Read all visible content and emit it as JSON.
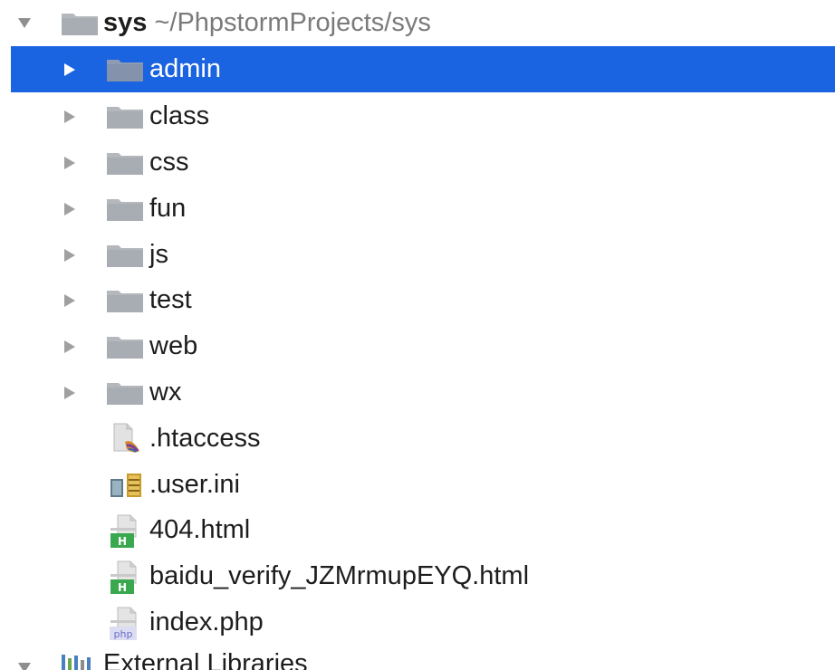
{
  "tree": {
    "root": {
      "name": "sys",
      "path": "~/PhpstormProjects/sys",
      "icon": "folder-icon",
      "expanded": true
    },
    "folders": [
      {
        "name": "admin",
        "icon": "folder-icon",
        "selected": true
      },
      {
        "name": "class",
        "icon": "folder-icon"
      },
      {
        "name": "css",
        "icon": "folder-icon"
      },
      {
        "name": "fun",
        "icon": "folder-icon"
      },
      {
        "name": "js",
        "icon": "folder-icon"
      },
      {
        "name": "test",
        "icon": "folder-icon"
      },
      {
        "name": "web",
        "icon": "folder-icon"
      },
      {
        "name": "wx",
        "icon": "folder-icon"
      }
    ],
    "files": [
      {
        "name": ".htaccess",
        "icon": "htaccess-file-icon"
      },
      {
        "name": ".user.ini",
        "icon": "ini-file-icon"
      },
      {
        "name": "404.html",
        "icon": "html-file-icon",
        "badge": "H"
      },
      {
        "name": "baidu_verify_JZMrmupEYQ.html",
        "icon": "html-file-icon",
        "badge": "H"
      },
      {
        "name": "index.php",
        "icon": "php-file-icon",
        "badge": "php"
      }
    ],
    "external": {
      "name": "External Libraries",
      "icon": "library-icon"
    }
  },
  "colors": {
    "selection": "#1a63e1",
    "folder": "#b4b8bd",
    "arrow": "#8f8f8f",
    "html_badge": "#39a84f",
    "php_badge": "#6b6fc4"
  }
}
